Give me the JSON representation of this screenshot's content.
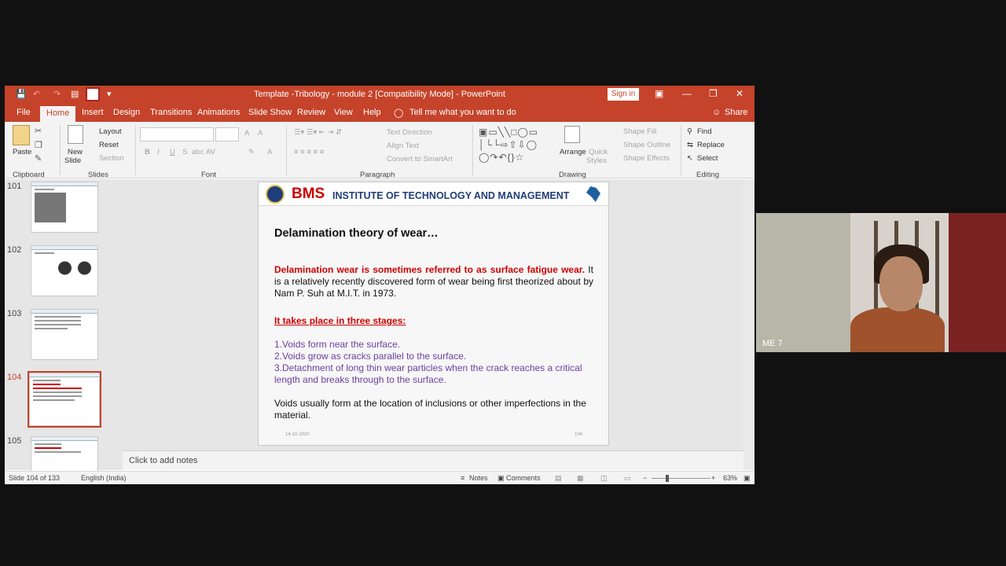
{
  "window": {
    "title": "Template -Tribology - module 2 [Compatibility Mode]  -  PowerPoint",
    "sign_in": "Sign in"
  },
  "tabs": [
    "File",
    "Home",
    "Insert",
    "Design",
    "Transitions",
    "Animations",
    "Slide Show",
    "Review",
    "View",
    "Help"
  ],
  "tell_me": "Tell me what you want to do",
  "share": "Share",
  "ribbon": {
    "clipboard": {
      "paste": "Paste",
      "group": "Clipboard"
    },
    "slides": {
      "new_slide_1": "New",
      "new_slide_2": "Slide",
      "layout": "Layout",
      "reset": "Reset",
      "section": "Section",
      "group": "Slides"
    },
    "font": {
      "group": "Font",
      "bold": "B",
      "italic": "I",
      "underline": "U",
      "strike": "S",
      "shadow": "abc",
      "spacing": "AV",
      "grow": "A",
      "shrink": "A",
      "color": "A"
    },
    "paragraph": {
      "group": "Paragraph",
      "text_direction": "Text Direction",
      "align_text": "Align Text",
      "smartart": "Convert to SmartArt"
    },
    "drawing": {
      "group": "Drawing",
      "arrange": "Arrange",
      "quick_1": "Quick",
      "quick_2": "Styles",
      "shape_fill": "Shape Fill",
      "shape_outline": "Shape Outline",
      "shape_effects": "Shape Effects"
    },
    "editing": {
      "group": "Editing",
      "find": "Find",
      "replace": "Replace",
      "select": "Select"
    }
  },
  "thumbnails": [
    {
      "num": "101",
      "selected": false
    },
    {
      "num": "102",
      "selected": false
    },
    {
      "num": "103",
      "selected": false
    },
    {
      "num": "104",
      "selected": true
    },
    {
      "num": "105",
      "selected": false
    }
  ],
  "slide": {
    "org_short": "BMS",
    "org_long": "INSTITUTE OF TECHNOLOGY AND MANAGEMENT",
    "title": "Delamination theory of wear…",
    "intro_red": "Delamination wear is sometimes referred to as surface fatigue wear.",
    "intro_rest": " It is a relatively recently discovered form of wear being first theorized about by Nam P. Suh at M.I.T. in 1973.",
    "stages_heading": "It takes place in three stages:",
    "stage_1": "1.Voids form near the surface.",
    "stage_2": "2.Voids grow as cracks parallel to the surface.",
    "stage_3": "3.Detachment of long thin wear particles when the crack reaches a critical length and breaks through to the surface.",
    "closing": "Voids usually form at the location of inclusions or other imperfections in the material.",
    "footer_date": "14-10-2020",
    "footer_page": "104"
  },
  "notes_placeholder": "Click to add notes",
  "status": {
    "slide": "Slide 104 of 133",
    "language": "English (India)",
    "notes": "Notes",
    "comments": "Comments",
    "zoom": "63%"
  },
  "video": {
    "label": "ME 7"
  },
  "colors": {
    "accent": "#c5432a",
    "title_red": "#d00000",
    "list_purple": "#6a3fa0",
    "inst_blue": "#1f3d7a"
  }
}
